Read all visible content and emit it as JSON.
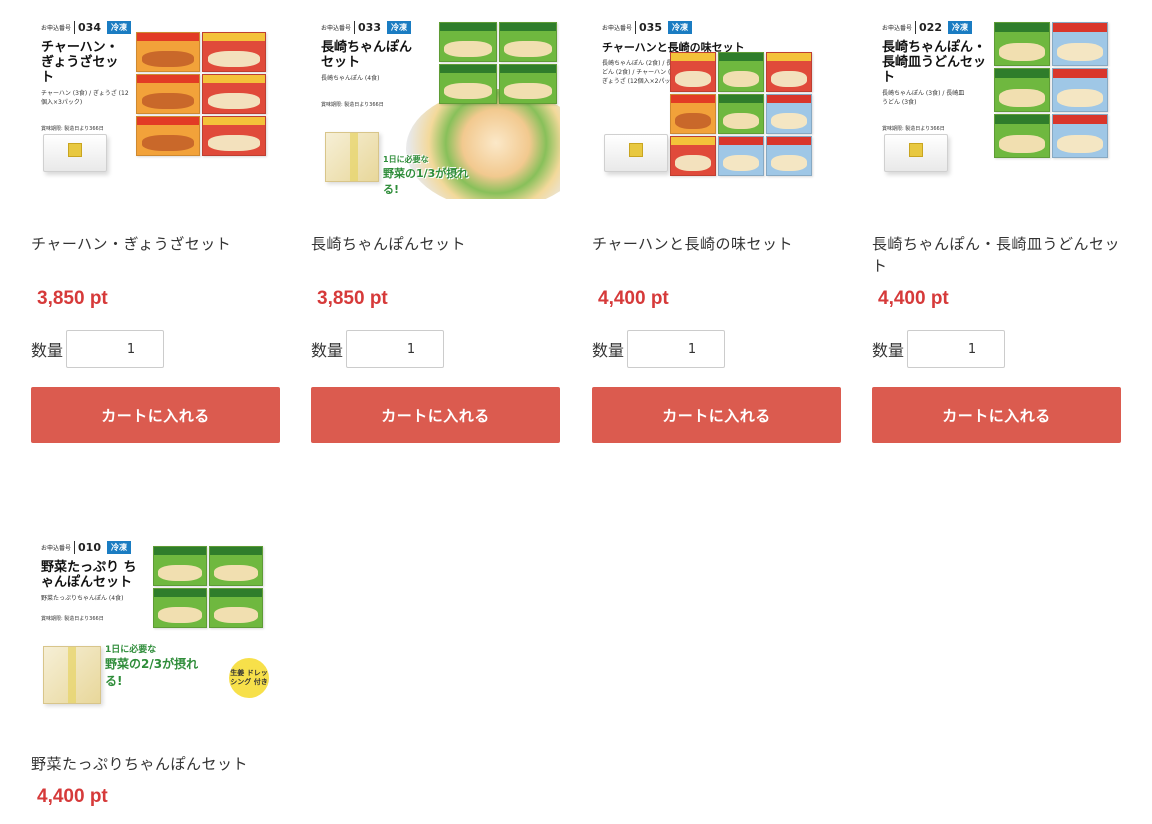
{
  "common": {
    "qty_label": "数量",
    "cart_label": "カートに入れる",
    "order_no_label": "お申込番号",
    "frozen_label": "冷凍",
    "expiry_text": "賞味期限: 製造日より366日"
  },
  "products": [
    {
      "name": "チャーハン・ぎょうざセット",
      "price": "3,850 pt",
      "qty": "1",
      "code": "034",
      "img_title": "チャーハン・ ぎょうざセット",
      "img_sub": "チャーハン (3食) / ぎょうざ (12個入×3パック)"
    },
    {
      "name": "長崎ちゃんぽんセット",
      "price": "3,850 pt",
      "qty": "1",
      "code": "033",
      "img_title": "長崎ちゃんぽん セット",
      "img_sub": "長崎ちゃんぽん (4食)",
      "badge_day": "1日に必要な",
      "badge_veg": "野菜の1/3が摂れる!"
    },
    {
      "name": "チャーハンと長崎の味セット",
      "price": "4,400 pt",
      "qty": "1",
      "code": "035",
      "img_title": "チャーハンと長崎の味セット",
      "img_sub": "長崎ちゃんぽん (2食) / 長崎皿うどん (2食) / チャーハン (1食) / ぎょうざ (12個入×2パック)"
    },
    {
      "name": "長崎ちゃんぽん・長崎皿うどんセット",
      "price": "4,400 pt",
      "qty": "1",
      "code": "022",
      "img_title": "長崎ちゃんぽん・ 長崎皿うどんセット",
      "img_sub": "長崎ちゃんぽん (3食) / 長崎皿うどん (3食)"
    },
    {
      "name": "野菜たっぷりちゃんぽんセット",
      "price": "4,400 pt",
      "code": "010",
      "img_title": "野菜たっぷり ちゃんぽんセット",
      "img_sub": "野菜たっぷりちゃんぽん (4食)",
      "badge_day": "1日に必要な",
      "badge_veg": "野菜の2/3が摂れる!",
      "badge_ginger": "生姜 ドレッシング 付き"
    }
  ]
}
